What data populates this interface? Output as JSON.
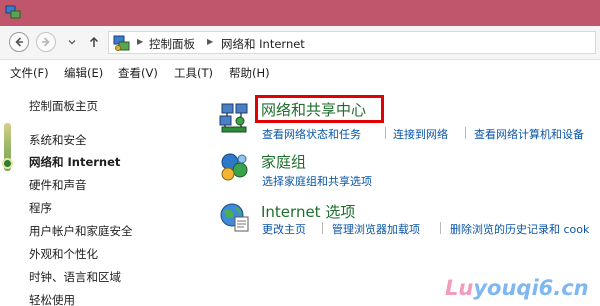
{
  "window": {
    "title_bar_color": "#c0566b"
  },
  "address": {
    "breadcrumbs": [
      "控制面板",
      "网络和 Internet"
    ]
  },
  "menu": {
    "items": [
      "文件(F)",
      "编辑(E)",
      "查看(V)",
      "工具(T)",
      "帮助(H)"
    ]
  },
  "sidebar": {
    "items": [
      {
        "label": "控制面板主页"
      },
      {
        "label": "系统和安全"
      },
      {
        "label": "网络和 Internet",
        "current": true
      },
      {
        "label": "硬件和声音"
      },
      {
        "label": "程序"
      },
      {
        "label": "用户帐户和家庭安全"
      },
      {
        "label": "外观和个性化"
      },
      {
        "label": "时钟、语言和区域"
      },
      {
        "label": "轻松使用"
      }
    ]
  },
  "categories": [
    {
      "title": "网络和共享中心",
      "icon": "network-sharing-center-icon",
      "highlighted": true,
      "links": [
        "查看网络状态和任务",
        "连接到网络",
        "查看网络计算机和设备"
      ]
    },
    {
      "title": "家庭组",
      "icon": "homegroup-icon",
      "links": [
        "选择家庭组和共享选项"
      ]
    },
    {
      "title": "Internet 选项",
      "icon": "internet-options-icon",
      "links": [
        "更改主页",
        "管理浏览器加载项",
        "删除浏览的历史记录和 cook"
      ]
    }
  ],
  "watermark": {
    "text": [
      "Lu",
      "youqi6.cn"
    ]
  },
  "colors": {
    "link": "#0a55a6",
    "category_title": "#1e6e2c",
    "highlight": "#e30000"
  }
}
